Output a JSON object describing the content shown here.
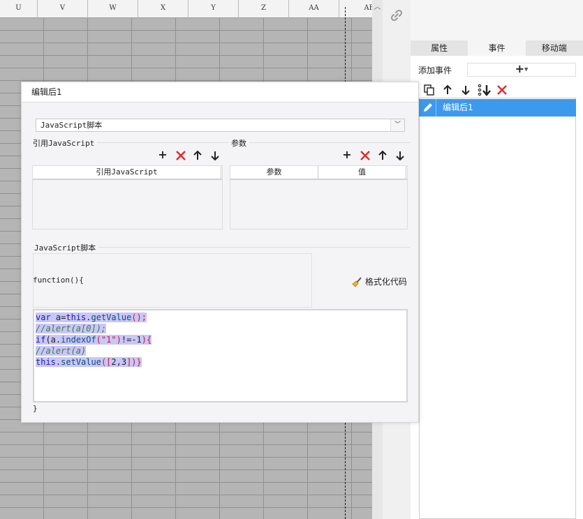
{
  "spreadsheet": {
    "columns": [
      "U",
      "V",
      "W",
      "X",
      "Y",
      "Z",
      "AA",
      "AB"
    ]
  },
  "right_panel": {
    "tabs": [
      {
        "label": "属性"
      },
      {
        "label": "事件"
      },
      {
        "label": "移动端"
      }
    ],
    "add_event_label": "添加事件",
    "add_event_button": "+",
    "events": [
      {
        "label": "编辑后1"
      }
    ]
  },
  "dialog": {
    "title": "编辑后1",
    "type_select": {
      "value": "JavaScript脚本"
    },
    "ref_js_section": {
      "label": "引用JavaScript",
      "columns": [
        "引用JavaScript"
      ]
    },
    "params_section": {
      "label": "参数",
      "columns": [
        "参数",
        "值"
      ]
    },
    "script_section": {
      "label": "JavaScript脚本",
      "function_header": "function(){",
      "format_button": "格式化代码",
      "closing_brace": "}"
    },
    "code_lines": [
      "var a=this.getValue();",
      "//alert(a[0]);",
      "if(a.indexOf(\"1\")!=-1){",
      "//alert(a)",
      "this.setValue([2,3])}"
    ]
  },
  "colors": {
    "selection_blue": "#3b99ee",
    "delete_red": "#e02a2a",
    "code_highlight": "#c9c6f8"
  }
}
